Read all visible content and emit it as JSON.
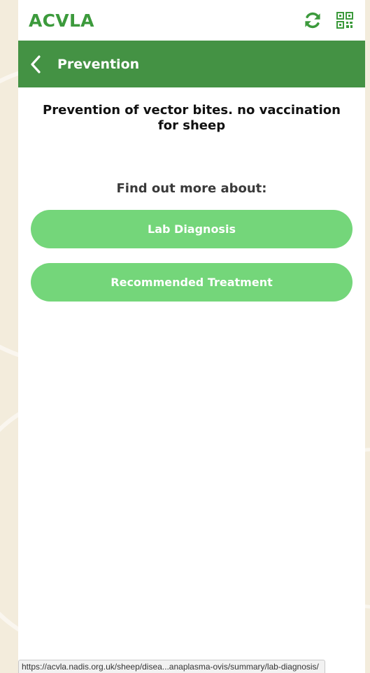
{
  "app": {
    "brand": "ACVLA"
  },
  "icons": {
    "refresh": "refresh-icon",
    "qr": "qr-code-icon",
    "back": "chevron-left-icon"
  },
  "colors": {
    "brand_green": "#3c9a3c",
    "nav_green": "#449244",
    "button_green": "#74d67a"
  },
  "nav": {
    "title": "Prevention"
  },
  "main": {
    "summary": "Prevention of vector bites. no vaccination for sheep",
    "find_more_label": "Find out more about:",
    "links": [
      {
        "label": "Lab Diagnosis"
      },
      {
        "label": "Recommended Treatment"
      }
    ]
  },
  "status_bar": {
    "url": "https://acvla.nadis.org.uk/sheep/disea...anaplasma-ovis/summary/lab-diagnosis/"
  }
}
